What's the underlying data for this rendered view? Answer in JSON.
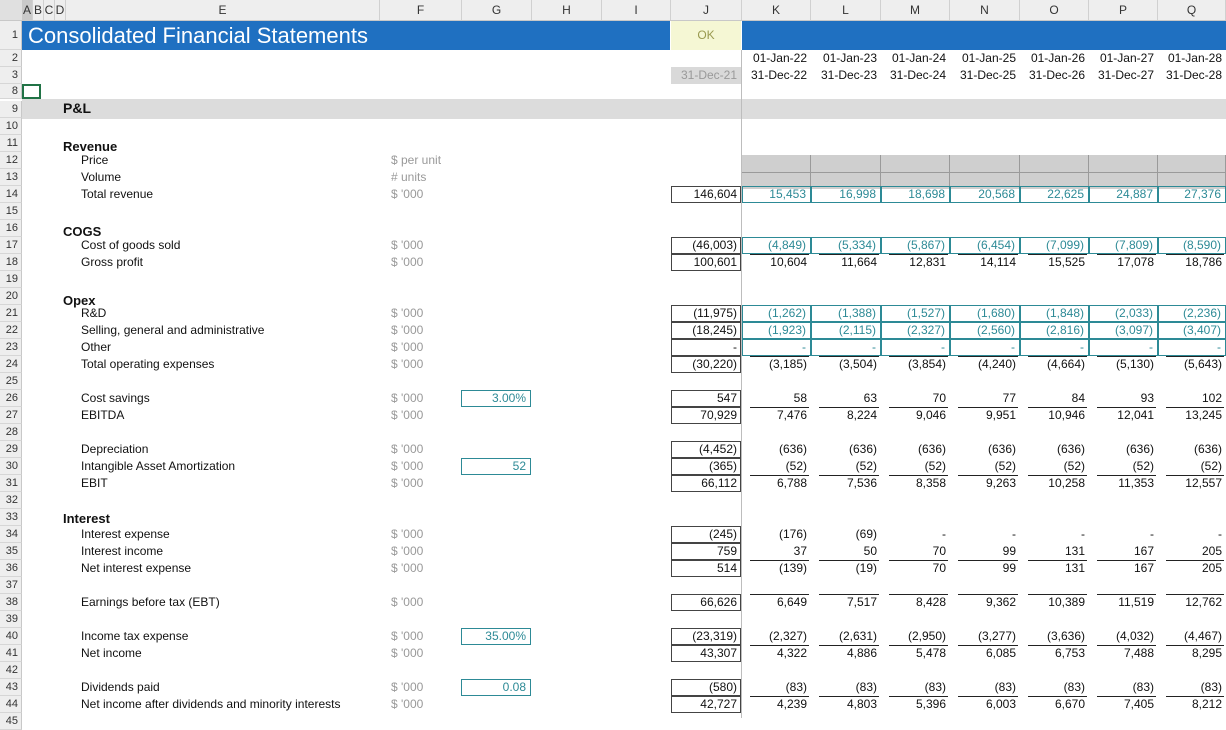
{
  "columns": [
    "A",
    "B",
    "C",
    "D",
    "E",
    "F",
    "G",
    "H",
    "I",
    "J",
    "K",
    "L",
    "M",
    "N",
    "O",
    "P",
    "Q"
  ],
  "row_numbers": [
    "1",
    "2",
    "3",
    "8",
    "9",
    "10",
    "11",
    "12",
    "13",
    "14",
    "15",
    "16",
    "17",
    "18",
    "19",
    "20",
    "21",
    "22",
    "23",
    "24",
    "25",
    "26",
    "27",
    "28",
    "29",
    "30",
    "31",
    "32",
    "33",
    "34",
    "35",
    "36",
    "37",
    "38",
    "39",
    "40",
    "41",
    "42",
    "43",
    "44",
    "45"
  ],
  "title": "Consolidated Financial Statements",
  "check": "OK",
  "j_date": "31-Dec-21",
  "period_starts": [
    "01-Jan-22",
    "01-Jan-23",
    "01-Jan-24",
    "01-Jan-25",
    "01-Jan-26",
    "01-Jan-27",
    "01-Jan-28"
  ],
  "period_ends": [
    "31-Dec-22",
    "31-Dec-23",
    "31-Dec-24",
    "31-Dec-25",
    "31-Dec-26",
    "31-Dec-27",
    "31-Dec-28"
  ],
  "section_pl": "P&L",
  "headings": {
    "revenue": "Revenue",
    "cogs": "COGS",
    "opex": "Opex",
    "interest": "Interest"
  },
  "rows": {
    "price": {
      "label": "Price",
      "unit": "$ per unit"
    },
    "volume": {
      "label": "Volume",
      "unit": "# units"
    },
    "total_revenue": {
      "label": "Total revenue",
      "unit": "$ '000",
      "j": "146,604",
      "vals": [
        "15,453",
        "16,998",
        "18,698",
        "20,568",
        "22,625",
        "24,887",
        "27,376"
      ]
    },
    "cogs": {
      "label": "Cost of goods sold",
      "unit": "$ '000",
      "j": "(46,003)",
      "vals": [
        "(4,849)",
        "(5,334)",
        "(5,867)",
        "(6,454)",
        "(7,099)",
        "(7,809)",
        "(8,590)"
      ]
    },
    "gross_profit": {
      "label": "Gross profit",
      "unit": "$ '000",
      "j": "100,601",
      "vals": [
        "10,604",
        "11,664",
        "12,831",
        "14,114",
        "15,525",
        "17,078",
        "18,786"
      ]
    },
    "rd": {
      "label": "R&D",
      "unit": "$ '000",
      "j": "(11,975)",
      "vals": [
        "(1,262)",
        "(1,388)",
        "(1,527)",
        "(1,680)",
        "(1,848)",
        "(2,033)",
        "(2,236)"
      ]
    },
    "sga": {
      "label": "Selling, general and administrative",
      "unit": "$ '000",
      "j": "(18,245)",
      "vals": [
        "(1,923)",
        "(2,115)",
        "(2,327)",
        "(2,560)",
        "(2,816)",
        "(3,097)",
        "(3,407)"
      ]
    },
    "other": {
      "label": "Other",
      "unit": "$ '000",
      "j": "-",
      "vals": [
        "-",
        "-",
        "-",
        "-",
        "-",
        "-",
        "-"
      ]
    },
    "total_opex": {
      "label": "Total operating expenses",
      "unit": "$ '000",
      "j": "(30,220)",
      "vals": [
        "(3,185)",
        "(3,504)",
        "(3,854)",
        "(4,240)",
        "(4,664)",
        "(5,130)",
        "(5,643)"
      ]
    },
    "cost_savings": {
      "label": "Cost savings",
      "unit": "$ '000",
      "input": "3.00%",
      "j": "547",
      "vals": [
        "58",
        "63",
        "70",
        "77",
        "84",
        "93",
        "102"
      ]
    },
    "ebitda": {
      "label": "EBITDA",
      "unit": "$ '000",
      "j": "70,929",
      "vals": [
        "7,476",
        "8,224",
        "9,046",
        "9,951",
        "10,946",
        "12,041",
        "13,245"
      ]
    },
    "depreciation": {
      "label": "Depreciation",
      "unit": "$ '000",
      "j": "(4,452)",
      "vals": [
        "(636)",
        "(636)",
        "(636)",
        "(636)",
        "(636)",
        "(636)",
        "(636)"
      ]
    },
    "amortization": {
      "label": "Intangible Asset Amortization",
      "unit": "$ '000",
      "input": "52",
      "j": "(365)",
      "vals": [
        "(52)",
        "(52)",
        "(52)",
        "(52)",
        "(52)",
        "(52)",
        "(52)"
      ]
    },
    "ebit": {
      "label": "EBIT",
      "unit": "$ '000",
      "j": "66,112",
      "vals": [
        "6,788",
        "7,536",
        "8,358",
        "9,263",
        "10,258",
        "11,353",
        "12,557"
      ]
    },
    "int_exp": {
      "label": "Interest expense",
      "unit": "$ '000",
      "j": "(245)",
      "vals": [
        "(176)",
        "(69)",
        "-",
        "-",
        "-",
        "-",
        "-"
      ]
    },
    "int_inc": {
      "label": "Interest income",
      "unit": "$ '000",
      "j": "759",
      "vals": [
        "37",
        "50",
        "70",
        "99",
        "131",
        "167",
        "205"
      ]
    },
    "net_int": {
      "label": "Net interest expense",
      "unit": "$ '000",
      "j": "514",
      "vals": [
        "(139)",
        "(19)",
        "70",
        "99",
        "131",
        "167",
        "205"
      ]
    },
    "ebt": {
      "label": "Earnings before tax (EBT)",
      "unit": "$ '000",
      "j": "66,626",
      "vals": [
        "6,649",
        "7,517",
        "8,428",
        "9,362",
        "10,389",
        "11,519",
        "12,762"
      ]
    },
    "tax": {
      "label": "Income tax expense",
      "unit": "$ '000",
      "input": "35.00%",
      "j": "(23,319)",
      "vals": [
        "(2,327)",
        "(2,631)",
        "(2,950)",
        "(3,277)",
        "(3,636)",
        "(4,032)",
        "(4,467)"
      ]
    },
    "net_income": {
      "label": "Net income",
      "unit": "$ '000",
      "j": "43,307",
      "vals": [
        "4,322",
        "4,886",
        "5,478",
        "6,085",
        "6,753",
        "7,488",
        "8,295"
      ]
    },
    "dividends": {
      "label": "Dividends paid",
      "unit": "$ '000",
      "input": "0.08",
      "j": "(580)",
      "vals": [
        "(83)",
        "(83)",
        "(83)",
        "(83)",
        "(83)",
        "(83)",
        "(83)"
      ]
    },
    "ni_after": {
      "label": "Net income after dividends and minority interests",
      "unit": "$ '000",
      "j": "42,727",
      "vals": [
        "4,239",
        "4,803",
        "5,396",
        "6,003",
        "6,670",
        "7,405",
        "8,212"
      ]
    }
  }
}
